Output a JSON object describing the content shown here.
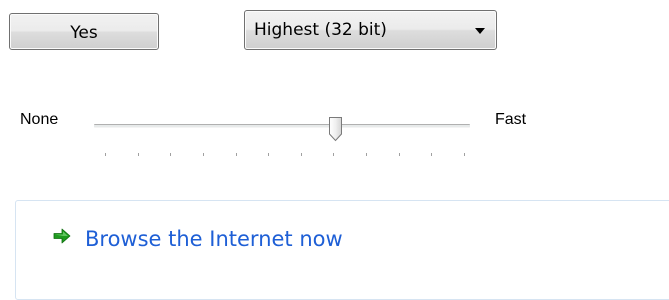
{
  "yes_button": {
    "label": "Yes"
  },
  "quality_dropdown": {
    "selected": "Highest (32 bit)",
    "icon": "chevron-down-icon"
  },
  "speed_slider": {
    "min_label": "None",
    "max_label": "Fast",
    "tick_count": 12,
    "value_fraction": 0.64
  },
  "task_link": {
    "icon": "green-arrow-right-icon",
    "label": "Browse the Internet now",
    "link_color": "#1e5fd6",
    "icon_color": "#1f9a1f"
  }
}
